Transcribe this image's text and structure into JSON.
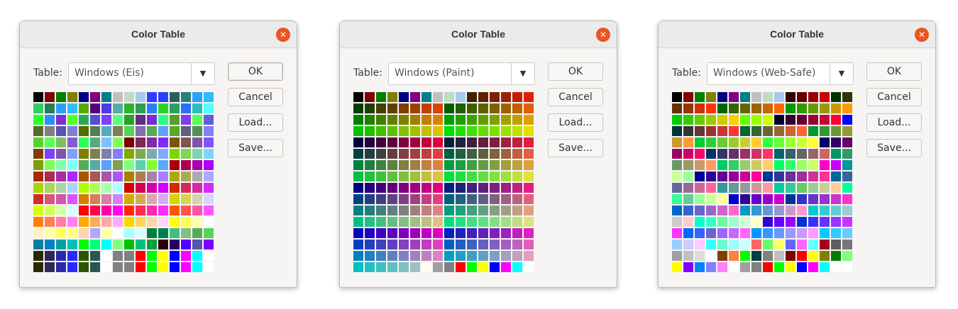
{
  "dialogs": [
    {
      "title": "Color Table",
      "table_label": "Table:",
      "selected_table": "Windows (Eis)",
      "buttons": {
        "ok": "OK",
        "cancel": "Cancel",
        "load": "Load...",
        "save": "Save..."
      },
      "ok_focused": true,
      "swatches": [
        [
          "#000000",
          "#800000",
          "#008000",
          "#808000",
          "#000080",
          "#800080",
          "#008080",
          "#c0c0c0",
          "#c0dcc0",
          "#a6caf0",
          "#2a3fff",
          "#2a3fff",
          "#2a5f5f",
          "#2a7f7f",
          "#2a9fff",
          "#2abfff"
        ],
        [
          "#2ad35f",
          "#2a7f55",
          "#2a9fff",
          "#2abfff",
          "#55aa00",
          "#550080",
          "#4b3ce6",
          "#55aaaa",
          "#2ab52a",
          "#2a9f55",
          "#2a7fff",
          "#2ad52a",
          "#2aa060",
          "#2a6fff",
          "#2abfbf",
          "#55ffff"
        ],
        [
          "#2aff2a",
          "#2a8fff",
          "#7b2fd6",
          "#55ff2a",
          "#2aaa55",
          "#554fd6",
          "#7f3fff",
          "#55ff7f",
          "#2a9f2a",
          "#5f2f7f",
          "#7a2ad6",
          "#2aff7f",
          "#559f2a",
          "#7f3fe6",
          "#55ff55",
          "#5f5fd6"
        ],
        [
          "#556b2f",
          "#7f7f7f",
          "#5555aa",
          "#7f7fd6",
          "#556b00",
          "#557f55",
          "#55aabf",
          "#7f7f55",
          "#55d555",
          "#7f6faa",
          "#55aa55",
          "#5fa0ff",
          "#55aa2a",
          "#5f5f7f",
          "#558f55",
          "#7f7fff"
        ],
        [
          "#55d52a",
          "#55ff55",
          "#7fbf5f",
          "#7f5fd6",
          "#2aff55",
          "#55aa7f",
          "#7fbfff",
          "#7fff55",
          "#7f0000",
          "#7f2a55",
          "#7f2aaa",
          "#7f2aff",
          "#7f5500",
          "#7f5555",
          "#7f55aa",
          "#7f55ff"
        ],
        [
          "#7f3f00",
          "#7f3fff",
          "#7f55aa",
          "#7fa0ff",
          "#7f7f00",
          "#7f7f55",
          "#7f7faa",
          "#7f7fff",
          "#7faa00",
          "#7faa55",
          "#7faaaa",
          "#7faaff",
          "#7fd500",
          "#7fd555",
          "#7fd5aa",
          "#7fd5ff"
        ],
        [
          "#7f9f00",
          "#7fff55",
          "#7fffaa",
          "#7fffff",
          "#55aa55",
          "#55aaaa",
          "#5f9fff",
          "#7f9f55",
          "#7fff7f",
          "#55d5aa",
          "#7fff2a",
          "#55aaff",
          "#aa0000",
          "#aa0055",
          "#aa00aa",
          "#aa00ff"
        ],
        [
          "#aa2a00",
          "#aa2a55",
          "#aa2aaa",
          "#aa2aff",
          "#aa5500",
          "#aa5555",
          "#aa55aa",
          "#aa55ff",
          "#aa7f00",
          "#aa7f55",
          "#aa7faa",
          "#aa7fff",
          "#aaaa00",
          "#aaaa55",
          "#aaaaaa",
          "#aaaaff"
        ],
        [
          "#aad500",
          "#aad555",
          "#aad5aa",
          "#aad5ff",
          "#aaff00",
          "#aaff55",
          "#aaffaa",
          "#aaffff",
          "#d50000",
          "#d50055",
          "#d500aa",
          "#d500ff",
          "#d52a00",
          "#d52a55",
          "#d52aaa",
          "#d52aff"
        ],
        [
          "#d52a2a",
          "#d5557f",
          "#d555aa",
          "#d555ff",
          "#d57f00",
          "#d57f55",
          "#d57faa",
          "#d57fff",
          "#d5aa00",
          "#d5aa55",
          "#d5aaaa",
          "#d5aaff",
          "#d5d500",
          "#d5d555",
          "#d5d5aa",
          "#d5d5ff"
        ],
        [
          "#d5ff00",
          "#d5ff55",
          "#d5ffaa",
          "#d5ffff",
          "#ff0000",
          "#ff0055",
          "#ff00aa",
          "#ff00ff",
          "#ff2a00",
          "#ff2a55",
          "#ff2aaa",
          "#ff2aff",
          "#ff5500",
          "#ff5555",
          "#ff55aa",
          "#ff55ff"
        ],
        [
          "#ff7f00",
          "#ff7f55",
          "#ff7faa",
          "#ff7fff",
          "#ffaa00",
          "#ffaa55",
          "#ffaaaa",
          "#ffaaff",
          "#ffd500",
          "#ffd555",
          "#ffd5aa",
          "#ffd5ff",
          "#ffff00",
          "#ffff55",
          "#ffffaa",
          "#ffffff"
        ],
        [
          "#fff0c0",
          "#ffffaa",
          "#ffff55",
          "#ffff7f",
          "#ffd5aa",
          "#aaaaff",
          "#ffffaa",
          "#ffffff",
          "#aaffff",
          "#d5ffff",
          "#008040",
          "#00804f",
          "#40c080",
          "#80c080",
          "#55aa55",
          "#55d555"
        ],
        [
          "#0080a0",
          "#0080c0",
          "#00a0a0",
          "#00c0c0",
          "#00ff00",
          "#00ff80",
          "#00ffff",
          "#80ff80",
          "#00c000",
          "#00c080",
          "#00a040",
          "#2a0000",
          "#2a005f",
          "#5500ff",
          "#5555aa",
          "#7f00ff"
        ],
        [
          "#2a2a00",
          "#2a2a55",
          "#2a2aaa",
          "#2a2aff",
          "#2a5500",
          "#2a5555",
          "#ffffff",
          "#808080",
          "#808080",
          "#ff0000",
          "#00ff00",
          "#ffff00",
          "#0000ff",
          "#ff00ff",
          "#00ffff",
          "#ffffff"
        ],
        [
          "#2a2a00",
          "#2a2a55",
          "#2a2aaa",
          "#2a2aff",
          "#2a5500",
          "#2a5555",
          "#ffffff",
          "#808080",
          "#808080",
          "#ff0000",
          "#00ff00",
          "#ffff00",
          "#0000ff",
          "#ff00ff",
          "#00ffff",
          "#ffffff"
        ]
      ]
    },
    {
      "title": "Color Table",
      "table_label": "Table:",
      "selected_table": "Windows (Paint)",
      "buttons": {
        "ok": "OK",
        "cancel": "Cancel",
        "load": "Load...",
        "save": "Save..."
      },
      "ok_focused": false,
      "swatches": [
        [
          "#000000",
          "#800000",
          "#008000",
          "#808000",
          "#000080",
          "#800080",
          "#008080",
          "#c0c0c0",
          "#c0dcc0",
          "#a6caf0",
          "#402000",
          "#602000",
          "#802000",
          "#a02000",
          "#c02000",
          "#e02000"
        ],
        [
          "#004000",
          "#204000",
          "#404000",
          "#604000",
          "#804000",
          "#a04000",
          "#c04000",
          "#e04000",
          "#006000",
          "#206000",
          "#406000",
          "#606000",
          "#806000",
          "#a06000",
          "#c06000",
          "#e06000"
        ],
        [
          "#008000",
          "#208000",
          "#408000",
          "#608000",
          "#808000",
          "#a08000",
          "#c08000",
          "#e08000",
          "#00a000",
          "#20a000",
          "#40a000",
          "#60a000",
          "#80a000",
          "#a0a000",
          "#c0a000",
          "#e0a000"
        ],
        [
          "#00c000",
          "#20c000",
          "#40c000",
          "#60c000",
          "#80c000",
          "#a0c000",
          "#c0c000",
          "#e0c000",
          "#00e000",
          "#20e000",
          "#40e000",
          "#60e000",
          "#80e000",
          "#a0e000",
          "#c0e000",
          "#e0e000"
        ],
        [
          "#000040",
          "#200040",
          "#400040",
          "#600040",
          "#800040",
          "#a00040",
          "#c00040",
          "#e00040",
          "#002040",
          "#202040",
          "#402040",
          "#602040",
          "#802040",
          "#a02040",
          "#c02040",
          "#e02040"
        ],
        [
          "#004040",
          "#204040",
          "#404040",
          "#604040",
          "#804040",
          "#a04040",
          "#c04040",
          "#e04040",
          "#006040",
          "#206040",
          "#406040",
          "#606040",
          "#806040",
          "#a06040",
          "#c06040",
          "#e06040"
        ],
        [
          "#008040",
          "#208040",
          "#408040",
          "#608040",
          "#808040",
          "#a08040",
          "#c08040",
          "#e08040",
          "#00a040",
          "#20a040",
          "#40a040",
          "#60a040",
          "#80a040",
          "#a0a040",
          "#c0a040",
          "#e0a040"
        ],
        [
          "#00c040",
          "#20c040",
          "#40c040",
          "#60c040",
          "#80c040",
          "#a0c040",
          "#c0c040",
          "#e0c040",
          "#00e040",
          "#20e040",
          "#40e040",
          "#60e040",
          "#80e040",
          "#a0e040",
          "#c0e040",
          "#e0e040"
        ],
        [
          "#000080",
          "#200080",
          "#400080",
          "#600080",
          "#800080",
          "#a00080",
          "#c00080",
          "#e00080",
          "#002080",
          "#202080",
          "#402080",
          "#602080",
          "#802080",
          "#a02080",
          "#c02080",
          "#e02080"
        ],
        [
          "#004080",
          "#204080",
          "#404080",
          "#604080",
          "#804080",
          "#a04080",
          "#c04080",
          "#e04080",
          "#006080",
          "#206080",
          "#406080",
          "#606080",
          "#806080",
          "#a06080",
          "#c06080",
          "#e06080"
        ],
        [
          "#008080",
          "#208080",
          "#408080",
          "#608080",
          "#808080",
          "#a08080",
          "#c08080",
          "#e08080",
          "#00a080",
          "#20a080",
          "#40a080",
          "#60a080",
          "#80a080",
          "#a0a080",
          "#c0a080",
          "#e0a080"
        ],
        [
          "#00c080",
          "#20c080",
          "#40c080",
          "#60c080",
          "#80c080",
          "#a0c080",
          "#c0c080",
          "#e0c080",
          "#00e080",
          "#20e080",
          "#40e080",
          "#60e080",
          "#80e080",
          "#a0e080",
          "#c0e080",
          "#e0e080"
        ],
        [
          "#0000c0",
          "#2000c0",
          "#4000c0",
          "#6000c0",
          "#8000c0",
          "#a000c0",
          "#c000c0",
          "#e000c0",
          "#0020c0",
          "#2020c0",
          "#4020c0",
          "#6020c0",
          "#8020c0",
          "#a020c0",
          "#c020c0",
          "#e020c0"
        ],
        [
          "#0040c0",
          "#2040c0",
          "#4040c0",
          "#6040c0",
          "#8040c0",
          "#a040c0",
          "#c040c0",
          "#e040c0",
          "#0060c0",
          "#2060c0",
          "#4060c0",
          "#6060c0",
          "#8060c0",
          "#a060c0",
          "#c060c0",
          "#e060c0"
        ],
        [
          "#0080c0",
          "#2080c0",
          "#4080c0",
          "#6080c0",
          "#8080c0",
          "#a080c0",
          "#c080c0",
          "#e080c0",
          "#00a0c0",
          "#20a0c0",
          "#40a0c0",
          "#60a0c0",
          "#80a0c0",
          "#a0a0c0",
          "#c0a0c0",
          "#e0a0c0"
        ],
        [
          "#00c0c0",
          "#20c0c0",
          "#40c0c0",
          "#60c0c0",
          "#80c0c0",
          "#a0c0c0",
          "#fffbf0",
          "#a0a0a4",
          "#808080",
          "#ff0000",
          "#00ff00",
          "#ffff00",
          "#0000ff",
          "#ff00ff",
          "#00ffff",
          "#ffffff"
        ]
      ]
    },
    {
      "title": "Color Table",
      "table_label": "Table:",
      "selected_table": "Windows (Web-Safe)",
      "buttons": {
        "ok": "OK",
        "cancel": "Cancel",
        "load": "Load...",
        "save": "Save..."
      },
      "ok_focused": false,
      "swatches": [
        [
          "#000000",
          "#800000",
          "#008000",
          "#808000",
          "#000080",
          "#800080",
          "#008080",
          "#c0c0c0",
          "#c0dcc0",
          "#a6caf0",
          "#330000",
          "#660000",
          "#990000",
          "#cc0000",
          "#003300",
          "#333300"
        ],
        [
          "#663300",
          "#993300",
          "#cc3300",
          "#ff3300",
          "#006600",
          "#336600",
          "#666600",
          "#996600",
          "#cc6600",
          "#ff6600",
          "#009900",
          "#339900",
          "#669900",
          "#999900",
          "#cc9900",
          "#ff9900"
        ],
        [
          "#00cc00",
          "#33cc00",
          "#66cc00",
          "#99cc00",
          "#cccc00",
          "#ffcc00",
          "#66ff00",
          "#99ff00",
          "#ccff00",
          "#000033",
          "#330033",
          "#660033",
          "#990033",
          "#cc0033",
          "#ff0033",
          "#0000ff"
        ],
        [
          "#003333",
          "#333333",
          "#663333",
          "#993333",
          "#cc3333",
          "#ff3333",
          "#006633",
          "#336633",
          "#666633",
          "#996633",
          "#cc6633",
          "#ff6633",
          "#009933",
          "#339933",
          "#669933",
          "#999933"
        ],
        [
          "#cc9933",
          "#ff9933",
          "#00cc33",
          "#33cc33",
          "#66cc33",
          "#99cc33",
          "#cccc33",
          "#ffcc33",
          "#33ff33",
          "#66ff33",
          "#99ff33",
          "#ccff33",
          "#ffff33",
          "#000066",
          "#330066",
          "#660066"
        ],
        [
          "#990066",
          "#cc0066",
          "#ff0066",
          "#003366",
          "#333366",
          "#663366",
          "#993366",
          "#cc3366",
          "#ff3366",
          "#006666",
          "#336666",
          "#666666",
          "#996666",
          "#cc6666",
          "#009966",
          "#339966"
        ],
        [
          "#669966",
          "#999966",
          "#cc9966",
          "#ff9966",
          "#00cc66",
          "#33cc66",
          "#99cc66",
          "#cccc66",
          "#ffcc66",
          "#00ff66",
          "#33ff66",
          "#99ff66",
          "#ccff66",
          "#ff00cc",
          "#cc00ff",
          "#009999"
        ],
        [
          "#ccff99",
          "#99ff99",
          "#000099",
          "#330099",
          "#660099",
          "#990099",
          "#cc0099",
          "#ff0099",
          "#003399",
          "#333399",
          "#663399",
          "#993399",
          "#cc3399",
          "#ff3399",
          "#006699",
          "#336699"
        ],
        [
          "#666699",
          "#996699",
          "#cc6699",
          "#ff6699",
          "#339999",
          "#669999",
          "#999999",
          "#cc9999",
          "#ff9999",
          "#00cc99",
          "#33cc99",
          "#66cc66",
          "#99cc99",
          "#cccc99",
          "#ffcc99",
          "#00ff99"
        ],
        [
          "#33ff99",
          "#66cc99",
          "#99ff99",
          "#ccff99",
          "#ffff99",
          "#0000cc",
          "#330099",
          "#6600cc",
          "#9900cc",
          "#cc00cc",
          "#003399",
          "#3333cc",
          "#6633cc",
          "#9933cc",
          "#cc33cc",
          "#ff33cc"
        ],
        [
          "#0066cc",
          "#3366cc",
          "#6666cc",
          "#9966cc",
          "#cc66cc",
          "#ff66cc",
          "#0099cc",
          "#3399cc",
          "#6699cc",
          "#9999cc",
          "#cc99cc",
          "#ff99cc",
          "#00cccc",
          "#33cccc",
          "#66cccc",
          "#99cccc"
        ],
        [
          "#cccccc",
          "#ffcccc",
          "#00ffcc",
          "#33ffcc",
          "#66ff99",
          "#99ffcc",
          "#ccffcc",
          "#ffffcc",
          "#3300cc",
          "#6600ff",
          "#9900ff",
          "#0033cc",
          "#3333ff",
          "#6633ff",
          "#9933ff",
          "#cc33ff"
        ],
        [
          "#ff33ff",
          "#0066ff",
          "#3366ff",
          "#6666cc",
          "#9966ff",
          "#cc66ff",
          "#ff66ff",
          "#0099ff",
          "#3399ff",
          "#6699ff",
          "#9999ff",
          "#cc99ff",
          "#ff99ff",
          "#00ccff",
          "#33ccff",
          "#66ccff"
        ],
        [
          "#99ccff",
          "#ccccff",
          "#ffccff",
          "#33ffff",
          "#66ffcc",
          "#99ffff",
          "#ccffff",
          "#ff6666",
          "#66ff66",
          "#ffff66",
          "#6666ff",
          "#ff66ff",
          "#66ffff",
          "#a50021",
          "#5f5f5f",
          "#777777"
        ],
        [
          "#a0a0a4",
          "#c0c0c0",
          "#dddddd",
          "#ffffff",
          "#804000",
          "#ff8040",
          "#00ff00",
          "#004040",
          "#808080",
          "#c0c0c0",
          "#800000",
          "#ff0000",
          "#ffff00",
          "#808000",
          "#008000",
          "#80ff80"
        ],
        [
          "#ffff00",
          "#8000ff",
          "#0080ff",
          "#8080ff",
          "#ff80ff",
          "#ffffff",
          "#a0a0a4",
          "#808080",
          "#ff0000",
          "#00ff00",
          "#ffff00",
          "#0000ff",
          "#ff00ff",
          "#00ffff",
          "#ffffff",
          "#ffffff"
        ]
      ]
    }
  ]
}
